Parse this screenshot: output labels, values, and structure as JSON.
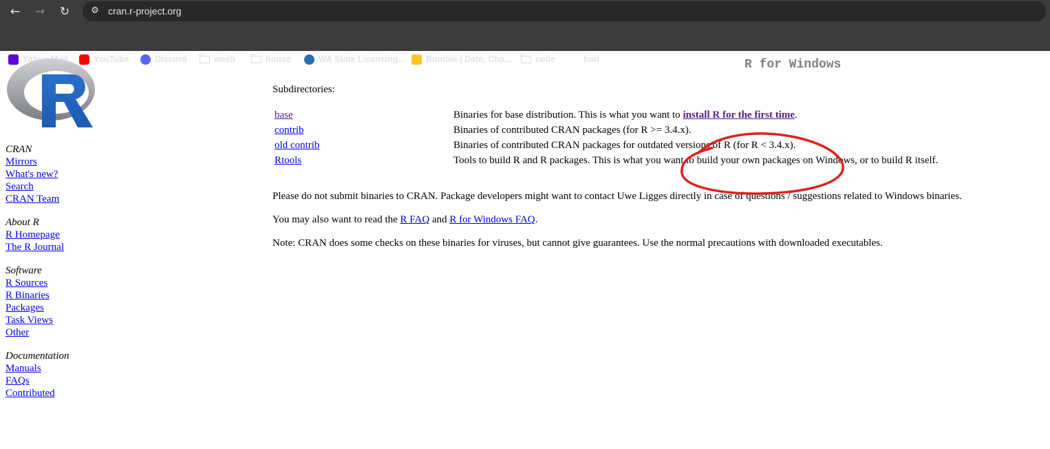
{
  "browser": {
    "url": "cran.r-project.org",
    "bookmarks": [
      {
        "label": "Yahoo Mail",
        "icon": "yahoo-mail-icon",
        "color": "#6001d2"
      },
      {
        "label": "YouTube",
        "icon": "youtube-icon",
        "color": "#ff0000"
      },
      {
        "label": "Discord",
        "icon": "discord-icon",
        "color": "#5865f2"
      },
      {
        "label": "weeb",
        "icon": "folder-icon"
      },
      {
        "label": "house",
        "icon": "folder-icon"
      },
      {
        "label": "WA State Licensing...",
        "icon": "wa-licensing-icon",
        "color": "#2a6fb0"
      },
      {
        "label": "Bumble | Date, Cha...",
        "icon": "bumble-icon",
        "color": "#ffc629"
      },
      {
        "label": "code",
        "icon": "folder-icon"
      },
      {
        "label": "fool",
        "icon": "github-icon",
        "color": "#ffffff"
      }
    ]
  },
  "page": {
    "title": "R for Windows",
    "sidebar": {
      "groups": [
        {
          "header": "CRAN",
          "links": [
            "Mirrors",
            "What's new?",
            "Search",
            "CRAN Team"
          ]
        },
        {
          "header": "About R",
          "links": [
            "R Homepage",
            "The R Journal"
          ]
        },
        {
          "header": "Software",
          "links": [
            "R Sources",
            "R Binaries",
            "Packages",
            "Task Views",
            "Other"
          ]
        },
        {
          "header": "Documentation",
          "links": [
            "Manuals",
            "FAQs",
            "Contributed"
          ]
        }
      ]
    },
    "subdirectories_label": "Subdirectories:",
    "subdirectories": [
      {
        "name": "base",
        "desc_pre": "Binaries for base distribution. This is what you want to ",
        "desc_link": "install R for the first time",
        "desc_post": "."
      },
      {
        "name": "contrib",
        "desc_pre": "Binaries of contributed CRAN packages (for R >= 3.4.x).",
        "desc_link": "",
        "desc_post": ""
      },
      {
        "name": "old contrib",
        "desc_pre": "Binaries of contributed CRAN packages for outdated versions of R (for R < 3.4.x).",
        "desc_link": "",
        "desc_post": ""
      },
      {
        "name": "Rtools",
        "desc_pre": "Tools to build R and R packages. This is what you want to build your own packages on Windows, or to build R itself.",
        "desc_link": "",
        "desc_post": ""
      }
    ],
    "para1": "Please do not submit binaries to CRAN. Package developers might want to contact Uwe Ligges directly in case of questions / suggestions related to Windows binaries.",
    "para2_pre": "You may also want to read the ",
    "para2_link1": "R FAQ",
    "para2_mid": " and ",
    "para2_link2": "R for Windows FAQ",
    "para2_post": ".",
    "para3": "Note: CRAN does some checks on these binaries for viruses, but cannot give guarantees. Use the normal precautions with downloaded executables.",
    "annotation_color": "#e02020"
  }
}
